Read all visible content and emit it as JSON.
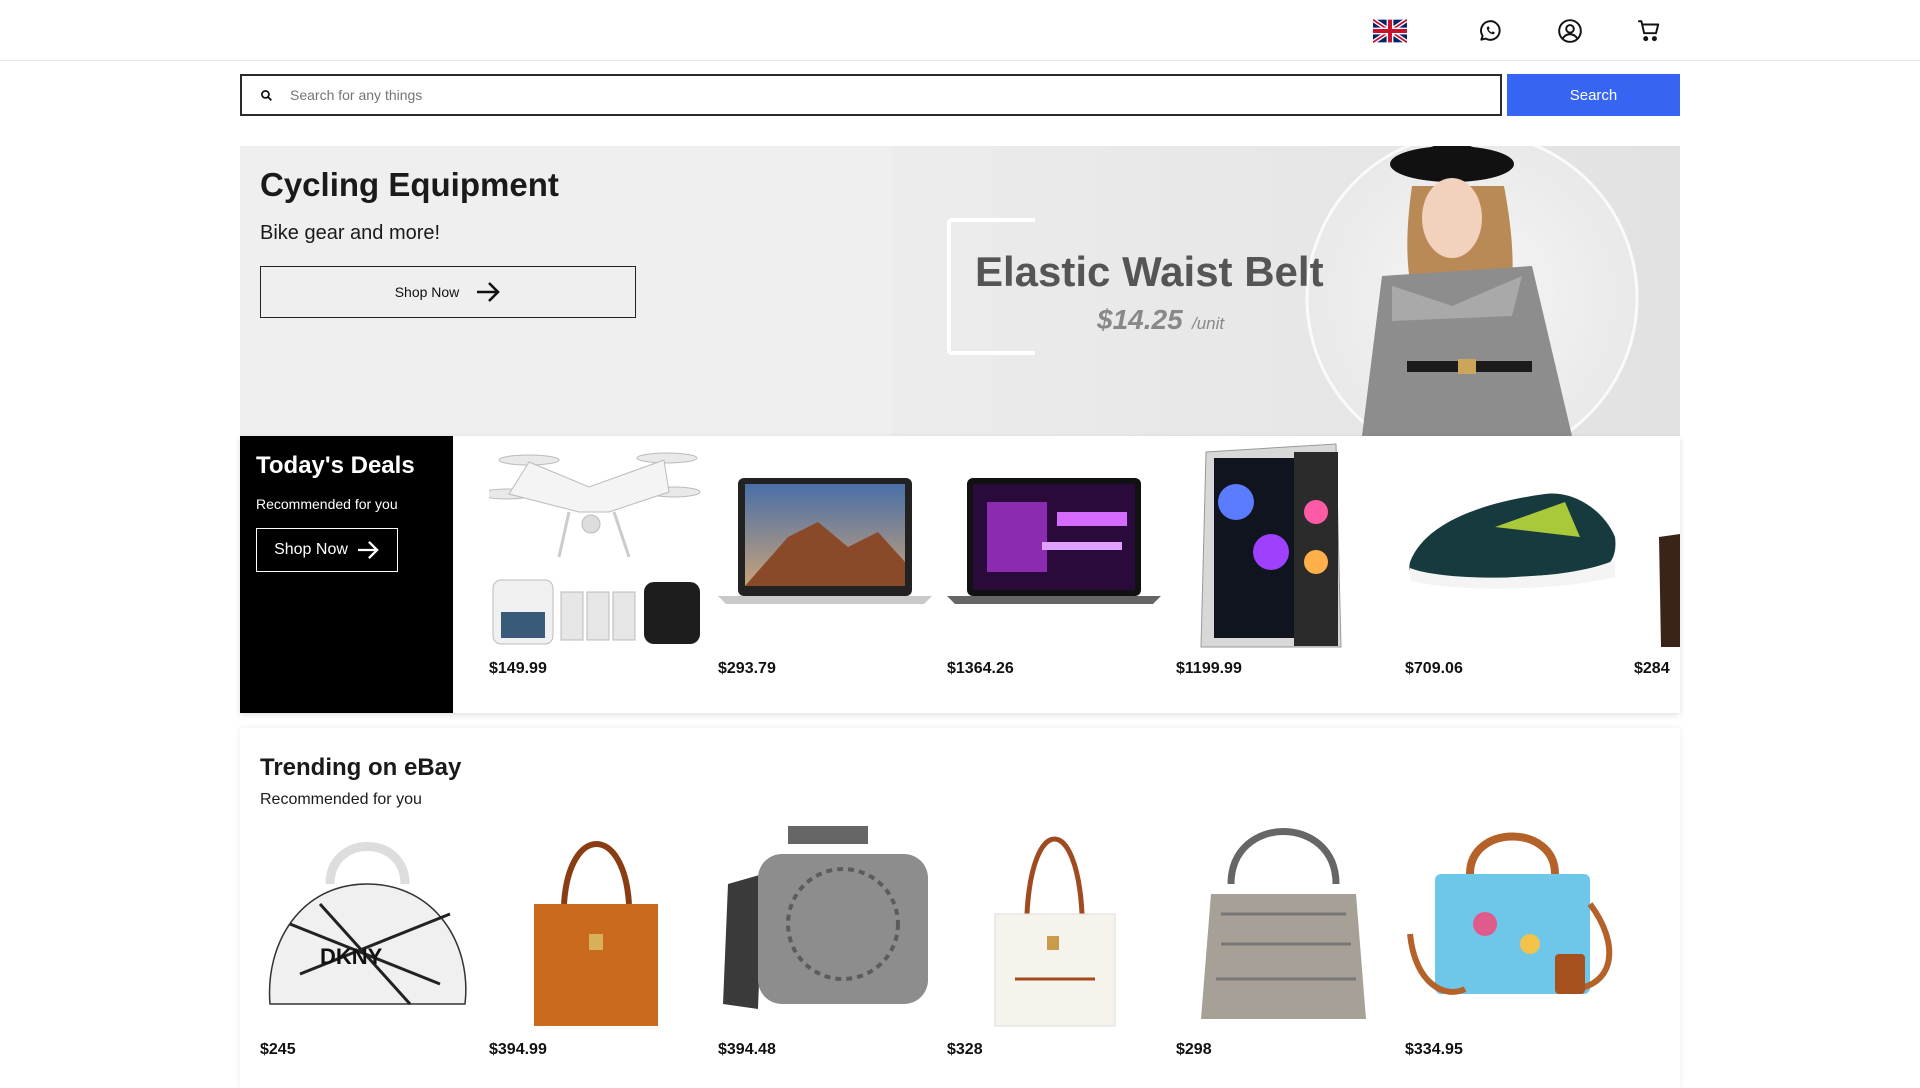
{
  "header": {
    "language_icon": "uk-flag-icon",
    "whatsapp_icon": "whatsapp-icon",
    "account_icon": "user-circle-icon",
    "cart_icon": "cart-icon"
  },
  "search": {
    "placeholder": "Search for any things",
    "button_label": "Search",
    "icon": "search-icon",
    "accent_color": "#3665f3"
  },
  "hero": {
    "title": "Cycling Equipment",
    "subtitle": "Bike gear and more!",
    "cta_label": "Shop Now",
    "promo_title": "Elastic Waist Belt",
    "promo_price": "$14.25",
    "promo_unit": "/unit"
  },
  "deals": {
    "title": "Today's Deals",
    "subtitle": "Recommended for you",
    "cta_label": "Shop Now",
    "items": [
      {
        "name": "drone",
        "price": "$149.99"
      },
      {
        "name": "laptop-silver",
        "price": "$293.79"
      },
      {
        "name": "laptop-dark",
        "price": "$1364.26"
      },
      {
        "name": "gaming-pc",
        "price": "$1199.99"
      },
      {
        "name": "running-shoe",
        "price": "$709.06"
      },
      {
        "name": "boot",
        "price": "$284"
      }
    ]
  },
  "trending": {
    "title": "Trending on eBay",
    "subtitle": "Recommended for you",
    "items": [
      {
        "name": "white-graffiti-bag",
        "price": "$245"
      },
      {
        "name": "orange-ostrich-tote",
        "price": "$394.99"
      },
      {
        "name": "grey-logo-bag",
        "price": "$394.48"
      },
      {
        "name": "white-tote",
        "price": "$328"
      },
      {
        "name": "silver-shoulder-bag",
        "price": "$298"
      },
      {
        "name": "blue-printed-satchel",
        "price": "$334.95"
      }
    ]
  }
}
